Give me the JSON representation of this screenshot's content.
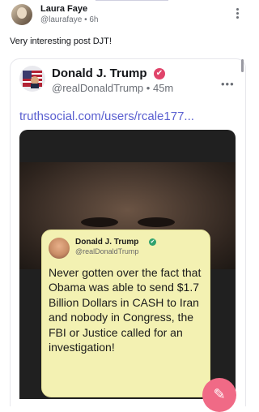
{
  "outer_post": {
    "author_name": "Laura Faye",
    "handle": "@laurafaye",
    "separator": "•",
    "time": "6h",
    "text": "Very interesting post DJT!"
  },
  "quoted_post": {
    "author_name": "Donald J. Trump",
    "handle": "@realDonaldTrump",
    "separator": "•",
    "time": "45m",
    "link": "truthsocial.com/users/rcale177..."
  },
  "media_tweet": {
    "author_name": "Donald J. Trump",
    "handle": "@realDonaldTrump",
    "text": "Never gotten over the fact that Obama was able to send $1.7 Billion Dollars in CASH to Iran and nobody in Congress, the FBI or Justice called for an investigation!"
  },
  "icons": {
    "verified": "✔",
    "more": "•••",
    "compose": "✎"
  },
  "colors": {
    "accent": "#5a5fd0",
    "verified_badge": "#e0446a",
    "fab": "#f06a86",
    "tweet_background": "#f3f1b2"
  }
}
